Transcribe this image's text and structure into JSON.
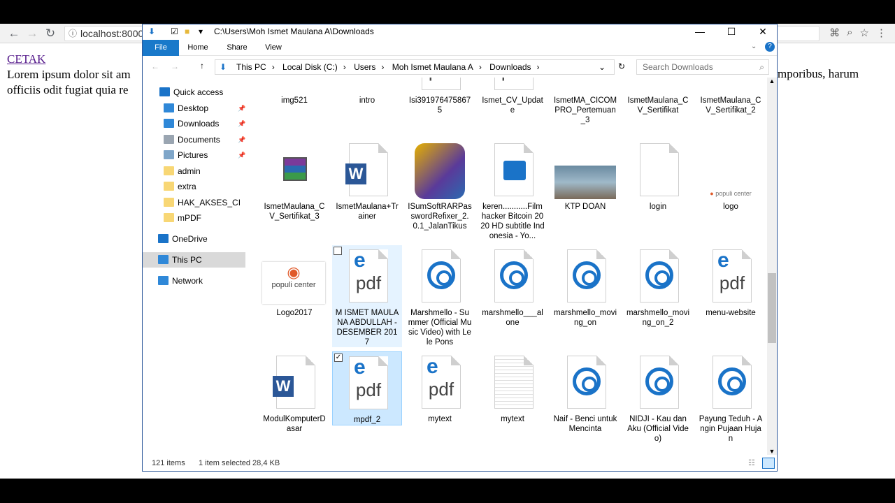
{
  "browser": {
    "url": "localhost:8000/",
    "info_icon": "info-icon"
  },
  "page": {
    "link": "CETAK",
    "line1": "Lorem ipsum dolor sit am",
    "line2": "officiis odit fugiat quia re",
    "right_text": "mporibus, harum"
  },
  "explorer": {
    "title": "C:\\Users\\Moh Ismet Maulana A\\Downloads",
    "minimize": "—",
    "maximize": "☐",
    "close": "✕",
    "tabs": [
      "File",
      "Home",
      "Share",
      "View"
    ],
    "crumbs": [
      "This PC",
      "Local Disk (C:)",
      "Users",
      "Moh Ismet Maulana A",
      "Downloads"
    ],
    "search_placeholder": "Search Downloads",
    "nav": [
      {
        "label": "Quick access",
        "icon": "star-icon",
        "color": "#1a73c8"
      },
      {
        "label": "Desktop",
        "icon": "desktop-icon",
        "color": "#2f88d8",
        "pin": "📌"
      },
      {
        "label": "Downloads",
        "icon": "download-icon",
        "color": "#2f88d8",
        "pin": "📌"
      },
      {
        "label": "Documents",
        "icon": "documents-icon",
        "color": "#9aa5b1",
        "pin": "📌"
      },
      {
        "label": "Pictures",
        "icon": "pictures-icon",
        "color": "#7fa6c9",
        "pin": "📌"
      },
      {
        "label": "admin",
        "icon": "folder-icon",
        "color": "#f8d775"
      },
      {
        "label": "extra",
        "icon": "folder-icon",
        "color": "#f8d775"
      },
      {
        "label": "HAK_AKSES_CI",
        "icon": "folder-icon",
        "color": "#f8d775"
      },
      {
        "label": "mPDF",
        "icon": "folder-icon",
        "color": "#f8d775"
      },
      {
        "label": "OneDrive",
        "icon": "cloud-icon",
        "color": "#1a73c8"
      },
      {
        "label": "This PC",
        "icon": "pc-icon",
        "color": "#2f88d8"
      },
      {
        "label": "Network",
        "icon": "network-icon",
        "color": "#2f88d8"
      }
    ],
    "files": [
      {
        "label": "img521",
        "type": "image"
      },
      {
        "label": "intro",
        "type": "video"
      },
      {
        "label": "Isi3919764758675",
        "type": "pdf"
      },
      {
        "label": "Ismet_CV_Update",
        "type": "pdf"
      },
      {
        "label": "IsmetMA_CICOMPRO_Pertemuan_3",
        "type": "rar"
      },
      {
        "label": "IsmetMaulana_CV_Sertifikat",
        "type": "rar"
      },
      {
        "label": "IsmetMaulana_CV_Sertifikat_2",
        "type": "rar"
      },
      {
        "label": "IsmetMaulana_CV_Sertifikat_3",
        "type": "rar"
      },
      {
        "label": "IsmetMaulana+Trainer",
        "type": "word"
      },
      {
        "label": "ISumSoftRARPasswordRefixer_2.0.1_JalanTikus",
        "type": "exe"
      },
      {
        "label": "keren...........Film hacker Bitcoin 2020 HD subtitle Indonesia - Yo...",
        "type": "film"
      },
      {
        "label": "KTP DOAN",
        "type": "photo"
      },
      {
        "label": "login",
        "type": "blank"
      },
      {
        "label": "logo",
        "type": "logo"
      },
      {
        "label": "Logo2017",
        "type": "logo2"
      },
      {
        "label": "M ISMET MAULANA ABDULLAH - DESEMBER 2017",
        "type": "pdf"
      },
      {
        "label": "Marshmello - Summer (Official Music Video) with Lele Pons",
        "type": "media"
      },
      {
        "label": "marshmello___alone",
        "type": "media"
      },
      {
        "label": "marshmello_moving_on",
        "type": "media"
      },
      {
        "label": "marshmello_moving_on_2",
        "type": "media"
      },
      {
        "label": "menu-website",
        "type": "pdf"
      },
      {
        "label": "ModulKomputerDasar",
        "type": "word"
      },
      {
        "label": "mpdf_2",
        "type": "pdf"
      },
      {
        "label": "mytext",
        "type": "pdf"
      },
      {
        "label": "mytext",
        "type": "text"
      },
      {
        "label": "Naif - Benci untuk Mencinta",
        "type": "media"
      },
      {
        "label": "NIDJI - Kau dan Aku (Official Video)",
        "type": "media"
      },
      {
        "label": "Payung Teduh - Angin Pujaan Hujan",
        "type": "media"
      }
    ],
    "status": {
      "items": "121 items",
      "selected": "1 item selected  28,4 KB"
    }
  }
}
